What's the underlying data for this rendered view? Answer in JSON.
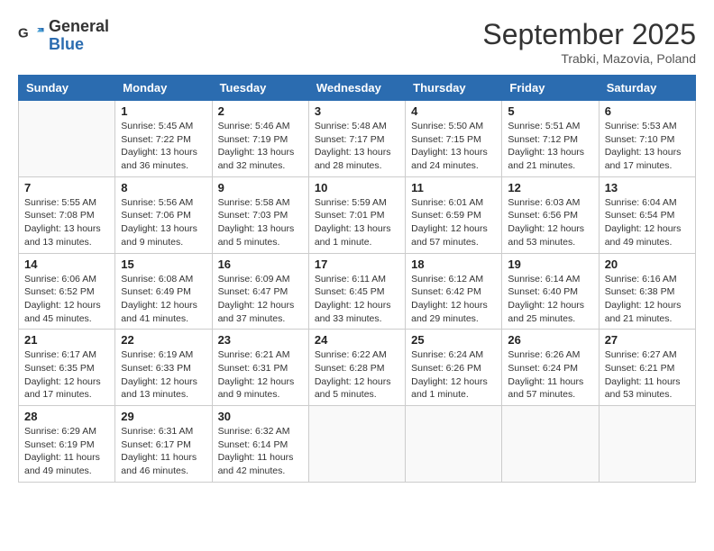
{
  "header": {
    "logo_general": "General",
    "logo_blue": "Blue",
    "month_title": "September 2025",
    "location": "Trabki, Mazovia, Poland"
  },
  "days_of_week": [
    "Sunday",
    "Monday",
    "Tuesday",
    "Wednesday",
    "Thursday",
    "Friday",
    "Saturday"
  ],
  "weeks": [
    [
      {
        "day": "",
        "info": ""
      },
      {
        "day": "1",
        "info": "Sunrise: 5:45 AM\nSunset: 7:22 PM\nDaylight: 13 hours\nand 36 minutes."
      },
      {
        "day": "2",
        "info": "Sunrise: 5:46 AM\nSunset: 7:19 PM\nDaylight: 13 hours\nand 32 minutes."
      },
      {
        "day": "3",
        "info": "Sunrise: 5:48 AM\nSunset: 7:17 PM\nDaylight: 13 hours\nand 28 minutes."
      },
      {
        "day": "4",
        "info": "Sunrise: 5:50 AM\nSunset: 7:15 PM\nDaylight: 13 hours\nand 24 minutes."
      },
      {
        "day": "5",
        "info": "Sunrise: 5:51 AM\nSunset: 7:12 PM\nDaylight: 13 hours\nand 21 minutes."
      },
      {
        "day": "6",
        "info": "Sunrise: 5:53 AM\nSunset: 7:10 PM\nDaylight: 13 hours\nand 17 minutes."
      }
    ],
    [
      {
        "day": "7",
        "info": "Sunrise: 5:55 AM\nSunset: 7:08 PM\nDaylight: 13 hours\nand 13 minutes."
      },
      {
        "day": "8",
        "info": "Sunrise: 5:56 AM\nSunset: 7:06 PM\nDaylight: 13 hours\nand 9 minutes."
      },
      {
        "day": "9",
        "info": "Sunrise: 5:58 AM\nSunset: 7:03 PM\nDaylight: 13 hours\nand 5 minutes."
      },
      {
        "day": "10",
        "info": "Sunrise: 5:59 AM\nSunset: 7:01 PM\nDaylight: 13 hours\nand 1 minute."
      },
      {
        "day": "11",
        "info": "Sunrise: 6:01 AM\nSunset: 6:59 PM\nDaylight: 12 hours\nand 57 minutes."
      },
      {
        "day": "12",
        "info": "Sunrise: 6:03 AM\nSunset: 6:56 PM\nDaylight: 12 hours\nand 53 minutes."
      },
      {
        "day": "13",
        "info": "Sunrise: 6:04 AM\nSunset: 6:54 PM\nDaylight: 12 hours\nand 49 minutes."
      }
    ],
    [
      {
        "day": "14",
        "info": "Sunrise: 6:06 AM\nSunset: 6:52 PM\nDaylight: 12 hours\nand 45 minutes."
      },
      {
        "day": "15",
        "info": "Sunrise: 6:08 AM\nSunset: 6:49 PM\nDaylight: 12 hours\nand 41 minutes."
      },
      {
        "day": "16",
        "info": "Sunrise: 6:09 AM\nSunset: 6:47 PM\nDaylight: 12 hours\nand 37 minutes."
      },
      {
        "day": "17",
        "info": "Sunrise: 6:11 AM\nSunset: 6:45 PM\nDaylight: 12 hours\nand 33 minutes."
      },
      {
        "day": "18",
        "info": "Sunrise: 6:12 AM\nSunset: 6:42 PM\nDaylight: 12 hours\nand 29 minutes."
      },
      {
        "day": "19",
        "info": "Sunrise: 6:14 AM\nSunset: 6:40 PM\nDaylight: 12 hours\nand 25 minutes."
      },
      {
        "day": "20",
        "info": "Sunrise: 6:16 AM\nSunset: 6:38 PM\nDaylight: 12 hours\nand 21 minutes."
      }
    ],
    [
      {
        "day": "21",
        "info": "Sunrise: 6:17 AM\nSunset: 6:35 PM\nDaylight: 12 hours\nand 17 minutes."
      },
      {
        "day": "22",
        "info": "Sunrise: 6:19 AM\nSunset: 6:33 PM\nDaylight: 12 hours\nand 13 minutes."
      },
      {
        "day": "23",
        "info": "Sunrise: 6:21 AM\nSunset: 6:31 PM\nDaylight: 12 hours\nand 9 minutes."
      },
      {
        "day": "24",
        "info": "Sunrise: 6:22 AM\nSunset: 6:28 PM\nDaylight: 12 hours\nand 5 minutes."
      },
      {
        "day": "25",
        "info": "Sunrise: 6:24 AM\nSunset: 6:26 PM\nDaylight: 12 hours\nand 1 minute."
      },
      {
        "day": "26",
        "info": "Sunrise: 6:26 AM\nSunset: 6:24 PM\nDaylight: 11 hours\nand 57 minutes."
      },
      {
        "day": "27",
        "info": "Sunrise: 6:27 AM\nSunset: 6:21 PM\nDaylight: 11 hours\nand 53 minutes."
      }
    ],
    [
      {
        "day": "28",
        "info": "Sunrise: 6:29 AM\nSunset: 6:19 PM\nDaylight: 11 hours\nand 49 minutes."
      },
      {
        "day": "29",
        "info": "Sunrise: 6:31 AM\nSunset: 6:17 PM\nDaylight: 11 hours\nand 46 minutes."
      },
      {
        "day": "30",
        "info": "Sunrise: 6:32 AM\nSunset: 6:14 PM\nDaylight: 11 hours\nand 42 minutes."
      },
      {
        "day": "",
        "info": ""
      },
      {
        "day": "",
        "info": ""
      },
      {
        "day": "",
        "info": ""
      },
      {
        "day": "",
        "info": ""
      }
    ]
  ]
}
